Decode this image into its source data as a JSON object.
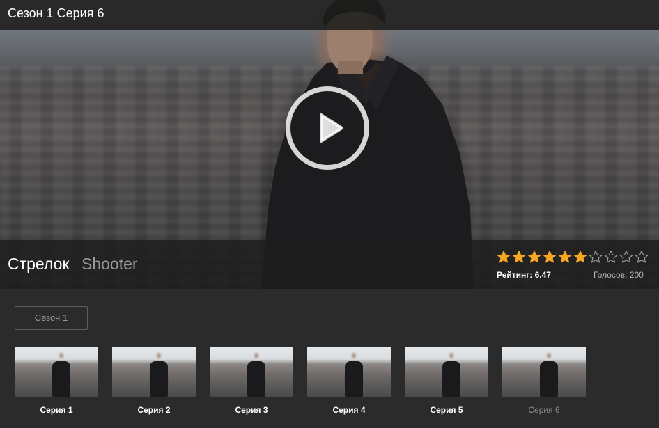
{
  "header": {
    "title": "Сезон 1 Серия 6"
  },
  "show": {
    "title_ru": "Стрелок",
    "title_en": "Shooter"
  },
  "rating": {
    "label": "Рейтинг: 6.47",
    "votes_label": "Голосов: 200",
    "stars_filled": 6,
    "stars_total": 10,
    "star_color": "#f5a623"
  },
  "season_selector": {
    "label": "Сезон 1"
  },
  "episodes": [
    {
      "label": "Серия 1"
    },
    {
      "label": "Серия 2"
    },
    {
      "label": "Серия 3"
    },
    {
      "label": "Серия 4"
    },
    {
      "label": "Серия 5"
    },
    {
      "label": "Серия 6"
    }
  ],
  "icons": {
    "play": "play-circle-icon",
    "star": "star-icon"
  }
}
